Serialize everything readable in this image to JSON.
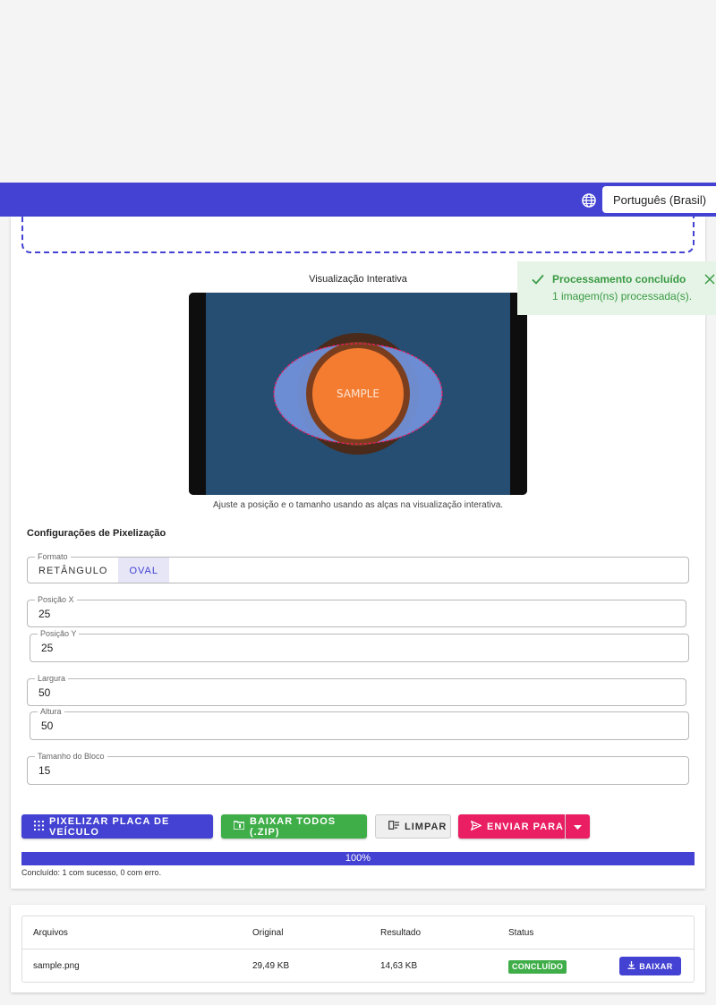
{
  "header": {
    "language_value": "Português (Brasil)",
    "globe_icon": "globe-icon"
  },
  "preview": {
    "title": "Visualização Interativa",
    "sample_text": "SAMPLE",
    "help_text": "Ajuste a posição e o tamanho usando as alças na visualização interativa."
  },
  "settings": {
    "title": "Configurações de Pixelização",
    "format_label": "Formato",
    "format_options": [
      "RETÂNGULO",
      "OVAL"
    ],
    "format_selected": "OVAL",
    "pos_x_label": "Posição X",
    "pos_x_value": "25",
    "pos_y_label": "Posição Y",
    "pos_y_value": "25",
    "width_label": "Largura",
    "width_value": "50",
    "height_label": "Altura",
    "height_value": "50",
    "block_label": "Tamanho do Bloco",
    "block_value": "15"
  },
  "actions": {
    "pixelate": "PIXELIZAR PLACA DE VEÍCULO",
    "download_all": "BAIXAR TODOS (.ZIP)",
    "clear": "LIMPAR",
    "send_to": "ENVIAR PARA"
  },
  "progress": {
    "value": 100,
    "label": "100%",
    "summary": "Concluído: 1 com sucesso, 0 com erro."
  },
  "toast": {
    "title": "Processamento concluído",
    "message": "1 imagem(ns) processada(s)."
  },
  "table": {
    "headers": [
      "Arquivos",
      "Original",
      "Resultado",
      "Status"
    ],
    "rows": [
      {
        "file": "sample.png",
        "original": "29,49 KB",
        "result": "14,63 KB",
        "status": "CONCLUÍDO",
        "action": "BAIXAR"
      }
    ]
  },
  "colors": {
    "primary": "#4342d2",
    "success": "#3fae49",
    "pink": "#e91e63",
    "toast_bg": "#e5f4e6"
  }
}
